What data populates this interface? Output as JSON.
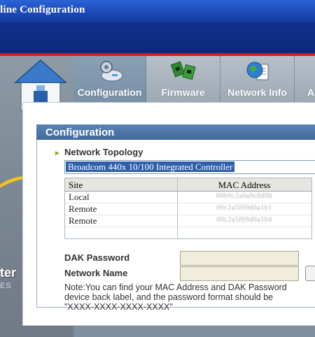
{
  "window": {
    "title": "line Configuration"
  },
  "branding": {
    "line1": "ter",
    "line2": "ES"
  },
  "toolbar": {
    "tabs": [
      {
        "label": "Configuration",
        "icon": "gear-disk-icon",
        "active": true
      },
      {
        "label": "Firmware",
        "icon": "chips-icon",
        "active": false
      },
      {
        "label": "Network Info",
        "icon": "globe-document-icon",
        "active": false
      },
      {
        "label": "A",
        "icon": "",
        "active": false
      }
    ]
  },
  "panel": {
    "title": "Configuration",
    "topology_label": "Network Topology",
    "adapter_selected": "Broadcom 440x 10/100 Integrated Controller",
    "table": {
      "headers": [
        "Site",
        "MAC Address"
      ],
      "rows": [
        {
          "site": "Local",
          "mac": "00b0c2a0a9c8d0b"
        },
        {
          "site": "Remote",
          "mac": "00c2a5f69d0a1b1"
        },
        {
          "site": "Remote",
          "mac": "00c2a5f69d0a1b4"
        }
      ]
    },
    "dak_label": "DAK Password",
    "network_name_label": "Network Name",
    "note_line1": "Note:You can find your MAC Address and DAK Password",
    "note_line2": "device back label, and the password format should be",
    "note_line3": "\"XXXX-XXXX-XXXX-XXXX\""
  },
  "colors": {
    "accent": "#4a73a5",
    "titlebar": "#1f4fc0",
    "redline": "#c8202a",
    "bullet": "#84b21c"
  }
}
